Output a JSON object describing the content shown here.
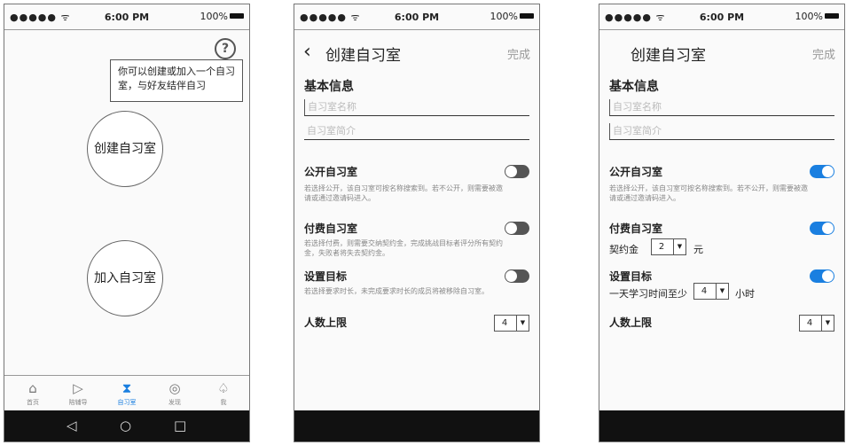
{
  "status": {
    "signal": "●●●●● ᯤ",
    "time": "6:00 PM",
    "battery": "100%"
  },
  "screen1": {
    "tooltip": "你可以创建或加入一个自习室，与好友结伴自习",
    "create_button": "创建自习室",
    "join_button": "加入自习室",
    "tabs": [
      {
        "label": "首页",
        "icon": "home-icon"
      },
      {
        "label": "陪辅导",
        "icon": "play-icon"
      },
      {
        "label": "自习室",
        "icon": "hourglass-icon"
      },
      {
        "label": "发现",
        "icon": "compass-icon"
      },
      {
        "label": "我",
        "icon": "profile-icon"
      }
    ]
  },
  "form": {
    "title": "创建自习室",
    "done": "完成",
    "basic_info": "基本信息",
    "name_placeholder": "自习室名称",
    "intro_placeholder": "自习室简介",
    "public_label": "公开自习室",
    "public_desc": "若选择公开，该自习室可按名称搜索到。若不公开，则需要被邀请或通过邀请码进入。",
    "paid_label": "付费自习室",
    "paid_desc": "若选择付费，则需要交纳契约金，完成挑战目标者评分所有契约金，失败者将失去契约金。",
    "goal_label": "设置目标",
    "goal_desc": "若选择要求时长，未完成要求时长的成员将被移除自习室。",
    "limit_label": "人数上限",
    "limit_value": "4"
  },
  "form_filled": {
    "deposit_label": "契约金",
    "deposit_value": "2",
    "deposit_unit": "元",
    "study_prefix": "一天学习时间至少",
    "study_value": "4",
    "study_unit": "小时"
  },
  "colors": {
    "accent": "#1a7fe0",
    "toggle_off": "#555555"
  }
}
